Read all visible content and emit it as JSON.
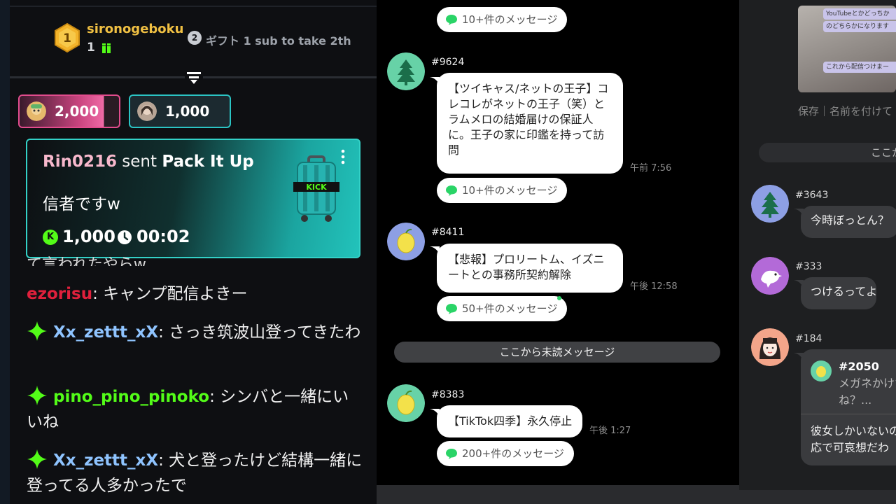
{
  "left": {
    "leaderboard": {
      "rank1_medal": "1",
      "rank1_name": "sironogeboku",
      "rank1_count": "1",
      "rank2_badge": "2",
      "rank2_text": "ギフト 1 sub to take 2th"
    },
    "pills": [
      {
        "amount": "2,000"
      },
      {
        "amount": "1,000"
      }
    ],
    "gift_card": {
      "user": "Rin0216",
      "verb": " sent ",
      "item": "Pack It Up",
      "message": "信者ですw",
      "kick_icon": "K",
      "amount": "1,000",
      "timer": "00:02",
      "suitcase_label": "KICK"
    },
    "clipped_line": "て言われたやらw",
    "messages": [
      {
        "user": "ezorisu",
        "color": "#e0203c",
        "badge": false,
        "text": "キャンプ配信よきー"
      },
      {
        "user": "Xx_zettt_xX",
        "color": "#8fc4ff",
        "badge": true,
        "text": "さっき筑波山登ってきたわ"
      },
      {
        "user": "pino_pino_pinoko",
        "color": "#53fc18",
        "badge": true,
        "text": "シンバと一緒にいいね"
      },
      {
        "user": "Xx_zettt_xX",
        "color": "#8fc4ff",
        "badge": true,
        "text": "犬と登ったけど結構一緒に登ってる人多かったで"
      }
    ]
  },
  "middle": {
    "top_badge": "10+件のメッセージ",
    "threads": [
      {
        "id": "#9624",
        "text": "【ツイキャス/ネットの王子】コレコレがネットの王子（笑）とラムメロの結婚届けの保証人に。王子の家に印鑑を持って訪問",
        "time": "午前 7:56",
        "badge": "10+件のメッセージ",
        "avatar": "tree-icon"
      },
      {
        "id": "#8411",
        "text": "【悲報】プロリートム、イズニートとの事務所契約解除",
        "time": "午後 12:58",
        "badge": "50+件のメッセージ",
        "avatar": "lemon-icon"
      },
      {
        "id": "#8383",
        "text": "【TikTok四季】永久停止",
        "time": "午後 1:27",
        "badge": "200+件のメッセージ",
        "avatar": "lemon-icon"
      }
    ],
    "unread_divider": "ここから未読メッセージ"
  },
  "right": {
    "thumb_lines": [
      "YouTubeとかどっちか",
      "のどちらかになります",
      "これから配信つけまー"
    ],
    "save_text": "保存｜名前を付けて",
    "unread_divider": "ここか",
    "items": [
      {
        "id": "#3643",
        "text": "今時ぼっとん？"
      },
      {
        "id": "#333",
        "text": "つけるってよ"
      },
      {
        "id": "#184",
        "quote_id": "#2050",
        "quote_text_1": "メガネかけた",
        "quote_text_2": "ね？...",
        "text_1": "彼女しかいないの",
        "text_2": "応で可哀想だわ"
      }
    ]
  },
  "colors": {
    "kick_green": "#53fc18",
    "line_green": "#2ad467",
    "gift_teal": "#1ba5a0",
    "pill_pink": "#e24c8d"
  }
}
